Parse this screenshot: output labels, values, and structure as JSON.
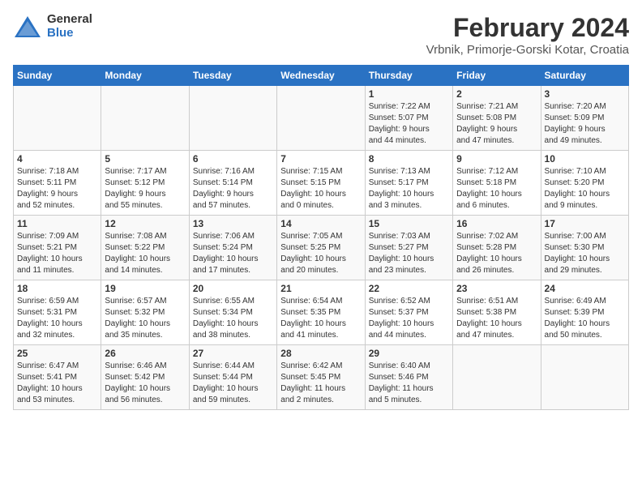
{
  "logo": {
    "general": "General",
    "blue": "Blue"
  },
  "title": {
    "month_year": "February 2024",
    "location": "Vrbnik, Primorje-Gorski Kotar, Croatia"
  },
  "days_of_week": [
    "Sunday",
    "Monday",
    "Tuesday",
    "Wednesday",
    "Thursday",
    "Friday",
    "Saturday"
  ],
  "weeks": [
    [
      {
        "day": "",
        "info": ""
      },
      {
        "day": "",
        "info": ""
      },
      {
        "day": "",
        "info": ""
      },
      {
        "day": "",
        "info": ""
      },
      {
        "day": "1",
        "info": "Sunrise: 7:22 AM\nSunset: 5:07 PM\nDaylight: 9 hours\nand 44 minutes."
      },
      {
        "day": "2",
        "info": "Sunrise: 7:21 AM\nSunset: 5:08 PM\nDaylight: 9 hours\nand 47 minutes."
      },
      {
        "day": "3",
        "info": "Sunrise: 7:20 AM\nSunset: 5:09 PM\nDaylight: 9 hours\nand 49 minutes."
      }
    ],
    [
      {
        "day": "4",
        "info": "Sunrise: 7:18 AM\nSunset: 5:11 PM\nDaylight: 9 hours\nand 52 minutes."
      },
      {
        "day": "5",
        "info": "Sunrise: 7:17 AM\nSunset: 5:12 PM\nDaylight: 9 hours\nand 55 minutes."
      },
      {
        "day": "6",
        "info": "Sunrise: 7:16 AM\nSunset: 5:14 PM\nDaylight: 9 hours\nand 57 minutes."
      },
      {
        "day": "7",
        "info": "Sunrise: 7:15 AM\nSunset: 5:15 PM\nDaylight: 10 hours\nand 0 minutes."
      },
      {
        "day": "8",
        "info": "Sunrise: 7:13 AM\nSunset: 5:17 PM\nDaylight: 10 hours\nand 3 minutes."
      },
      {
        "day": "9",
        "info": "Sunrise: 7:12 AM\nSunset: 5:18 PM\nDaylight: 10 hours\nand 6 minutes."
      },
      {
        "day": "10",
        "info": "Sunrise: 7:10 AM\nSunset: 5:20 PM\nDaylight: 10 hours\nand 9 minutes."
      }
    ],
    [
      {
        "day": "11",
        "info": "Sunrise: 7:09 AM\nSunset: 5:21 PM\nDaylight: 10 hours\nand 11 minutes."
      },
      {
        "day": "12",
        "info": "Sunrise: 7:08 AM\nSunset: 5:22 PM\nDaylight: 10 hours\nand 14 minutes."
      },
      {
        "day": "13",
        "info": "Sunrise: 7:06 AM\nSunset: 5:24 PM\nDaylight: 10 hours\nand 17 minutes."
      },
      {
        "day": "14",
        "info": "Sunrise: 7:05 AM\nSunset: 5:25 PM\nDaylight: 10 hours\nand 20 minutes."
      },
      {
        "day": "15",
        "info": "Sunrise: 7:03 AM\nSunset: 5:27 PM\nDaylight: 10 hours\nand 23 minutes."
      },
      {
        "day": "16",
        "info": "Sunrise: 7:02 AM\nSunset: 5:28 PM\nDaylight: 10 hours\nand 26 minutes."
      },
      {
        "day": "17",
        "info": "Sunrise: 7:00 AM\nSunset: 5:30 PM\nDaylight: 10 hours\nand 29 minutes."
      }
    ],
    [
      {
        "day": "18",
        "info": "Sunrise: 6:59 AM\nSunset: 5:31 PM\nDaylight: 10 hours\nand 32 minutes."
      },
      {
        "day": "19",
        "info": "Sunrise: 6:57 AM\nSunset: 5:32 PM\nDaylight: 10 hours\nand 35 minutes."
      },
      {
        "day": "20",
        "info": "Sunrise: 6:55 AM\nSunset: 5:34 PM\nDaylight: 10 hours\nand 38 minutes."
      },
      {
        "day": "21",
        "info": "Sunrise: 6:54 AM\nSunset: 5:35 PM\nDaylight: 10 hours\nand 41 minutes."
      },
      {
        "day": "22",
        "info": "Sunrise: 6:52 AM\nSunset: 5:37 PM\nDaylight: 10 hours\nand 44 minutes."
      },
      {
        "day": "23",
        "info": "Sunrise: 6:51 AM\nSunset: 5:38 PM\nDaylight: 10 hours\nand 47 minutes."
      },
      {
        "day": "24",
        "info": "Sunrise: 6:49 AM\nSunset: 5:39 PM\nDaylight: 10 hours\nand 50 minutes."
      }
    ],
    [
      {
        "day": "25",
        "info": "Sunrise: 6:47 AM\nSunset: 5:41 PM\nDaylight: 10 hours\nand 53 minutes."
      },
      {
        "day": "26",
        "info": "Sunrise: 6:46 AM\nSunset: 5:42 PM\nDaylight: 10 hours\nand 56 minutes."
      },
      {
        "day": "27",
        "info": "Sunrise: 6:44 AM\nSunset: 5:44 PM\nDaylight: 10 hours\nand 59 minutes."
      },
      {
        "day": "28",
        "info": "Sunrise: 6:42 AM\nSunset: 5:45 PM\nDaylight: 11 hours\nand 2 minutes."
      },
      {
        "day": "29",
        "info": "Sunrise: 6:40 AM\nSunset: 5:46 PM\nDaylight: 11 hours\nand 5 minutes."
      },
      {
        "day": "",
        "info": ""
      },
      {
        "day": "",
        "info": ""
      }
    ]
  ]
}
